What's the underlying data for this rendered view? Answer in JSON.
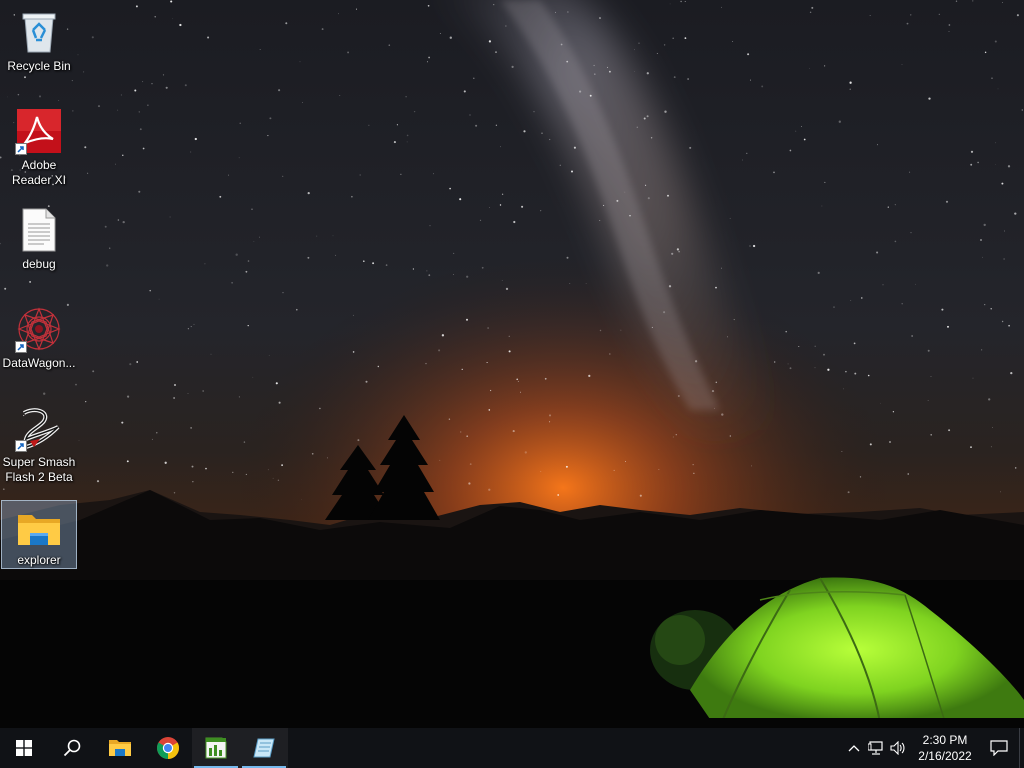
{
  "desktop": {
    "icons": [
      {
        "label": "Recycle Bin",
        "icon": "recycle-bin-icon"
      },
      {
        "label": "Adobe Reader XI",
        "icon": "adobe-reader-icon"
      },
      {
        "label": "debug",
        "icon": "text-file-icon"
      },
      {
        "label": "DataWagon...",
        "icon": "datawagon-icon"
      },
      {
        "label": "Super Smash Flash 2 Beta",
        "icon": "ssf2-icon"
      },
      {
        "label": "explorer",
        "icon": "folder-icon"
      }
    ],
    "selected_icon": "explorer"
  },
  "taskbar": {
    "buttons": [
      {
        "icon": "windows-start-icon"
      },
      {
        "icon": "search-icon"
      },
      {
        "icon": "file-explorer-icon"
      },
      {
        "icon": "chrome-icon"
      },
      {
        "icon": "spreadsheet-app-icon",
        "active": true
      },
      {
        "icon": "notepad-app-icon",
        "active": true
      }
    ],
    "tray": {
      "icons": [
        "chevron-up-icon",
        "network-icon",
        "volume-icon"
      ],
      "time": "2:30 PM",
      "date": "2/16/2022"
    }
  },
  "colors": {
    "accent": "#76b9ed",
    "taskbar": "#101216",
    "selection": "#84a0be"
  }
}
